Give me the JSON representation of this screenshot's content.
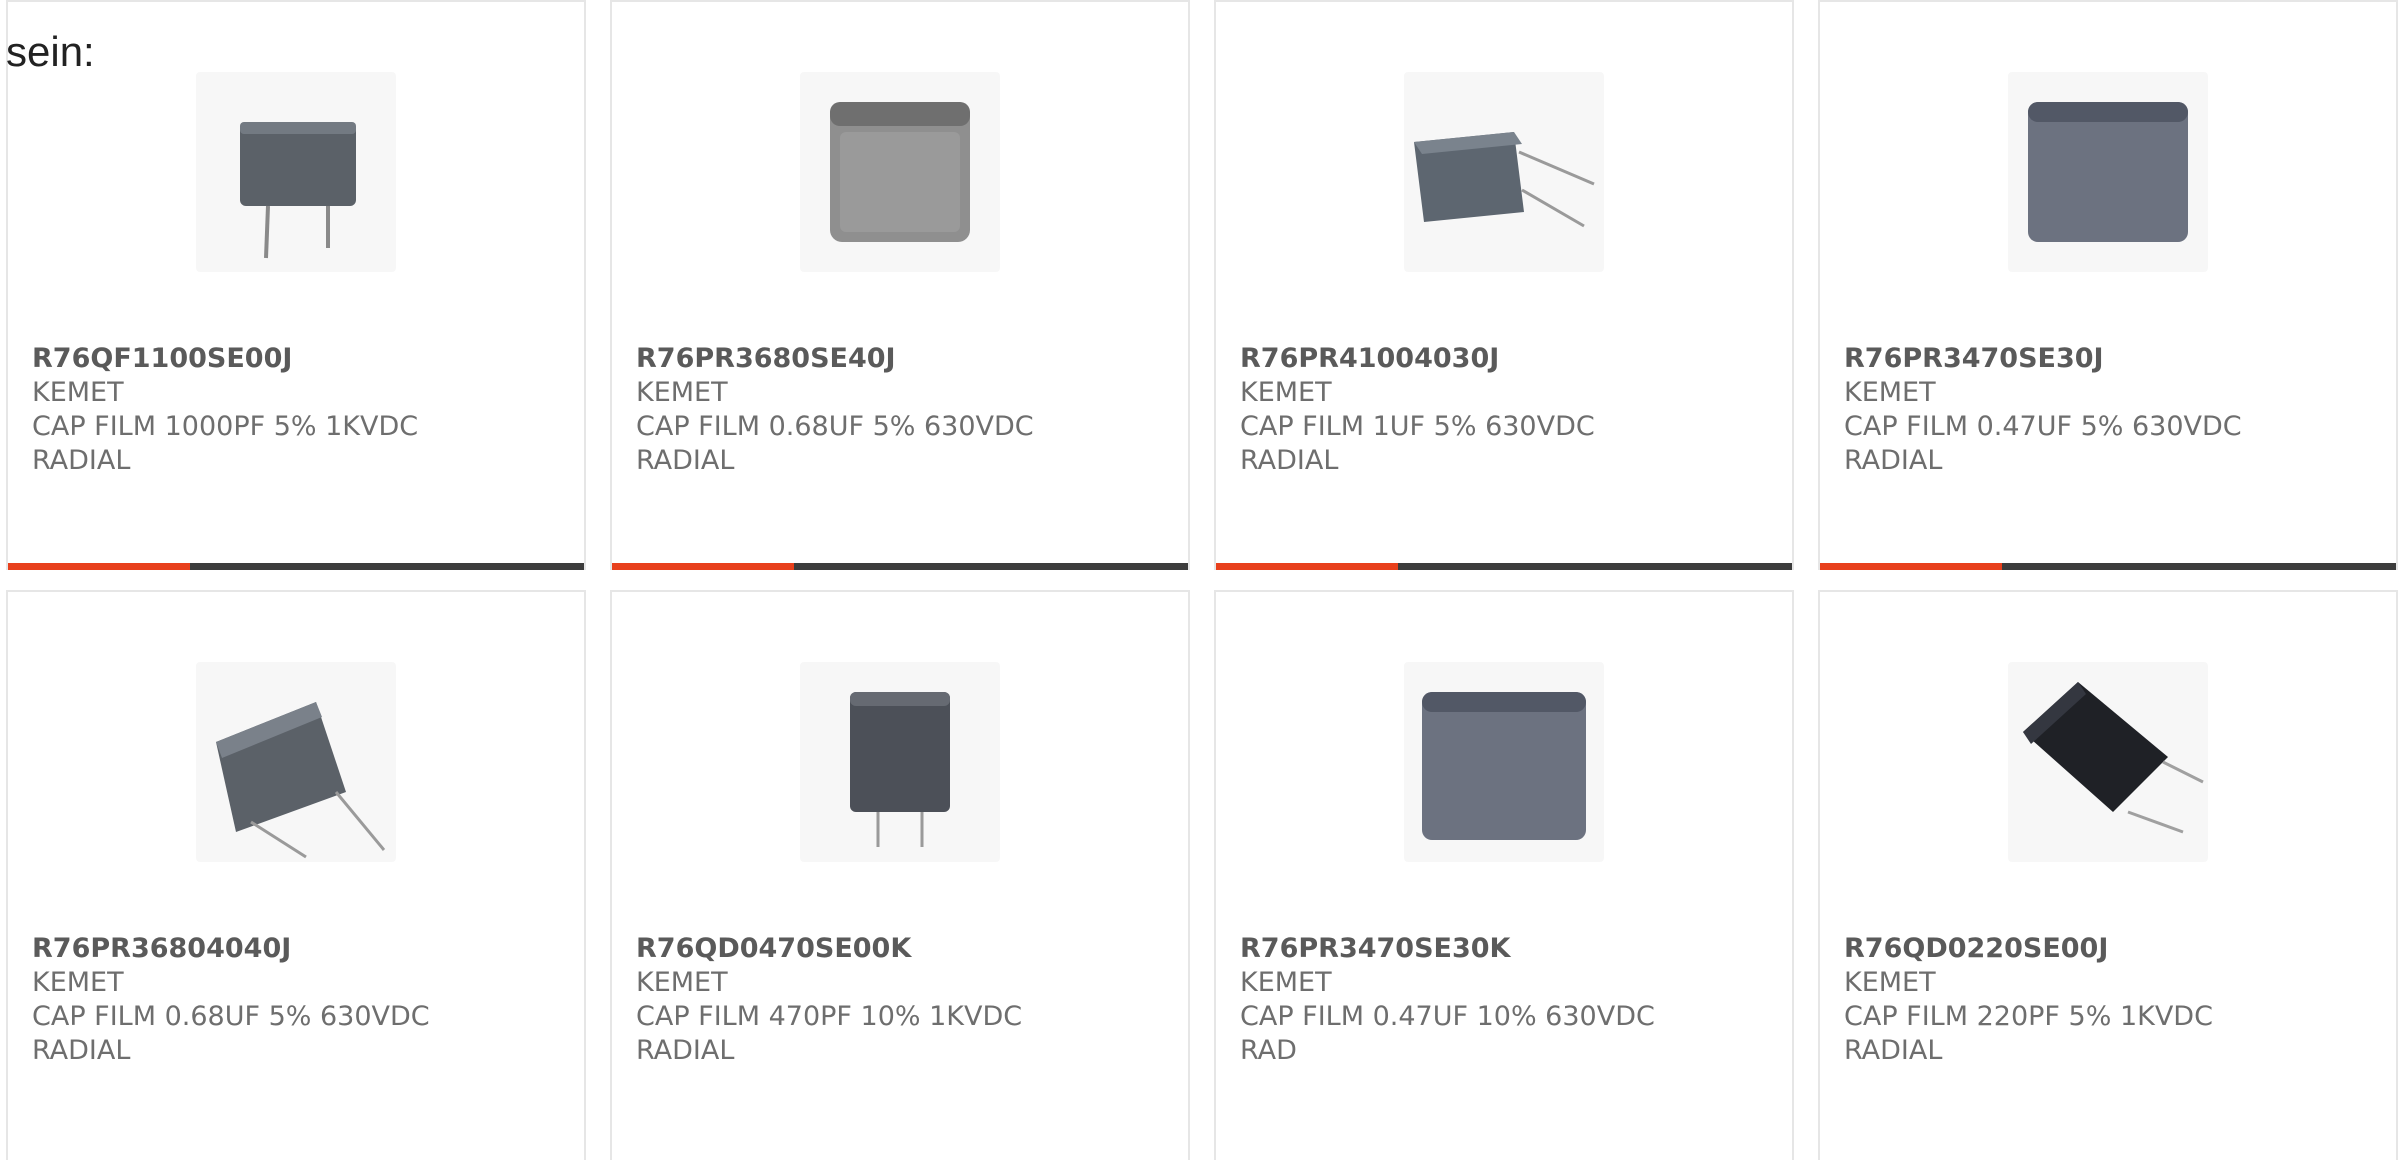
{
  "intro_text": "sein:",
  "colors": {
    "accent": "#e8401c",
    "bar": "#3c3c3c",
    "text": "#6e6e6e",
    "border": "#e6e6e6"
  },
  "products": [
    {
      "part": "R76QF1100SE00J",
      "maker": "KEMET",
      "desc1": "CAP FILM 1000PF 5% 1KVDC",
      "desc2": "RADIAL",
      "icon": "film-capacitor-icon",
      "style": "rect-legs-down"
    },
    {
      "part": "R76PR3680SE40J",
      "maker": "KEMET",
      "desc1": "CAP FILM 0.68UF 5% 630VDC",
      "desc2": "RADIAL",
      "icon": "film-capacitor-icon",
      "style": "box-gray"
    },
    {
      "part": "R76PR41004030J",
      "maker": "KEMET",
      "desc1": "CAP FILM 1UF 5% 630VDC",
      "desc2": "RADIAL",
      "icon": "film-capacitor-icon",
      "style": "angled-legs-right"
    },
    {
      "part": "R76PR3470SE30J",
      "maker": "KEMET",
      "desc1": "CAP FILM 0.47UF 5% 630VDC",
      "desc2": "RADIAL",
      "icon": "film-capacitor-icon",
      "style": "box-blue-gray"
    },
    {
      "part": "R76PR36804040J",
      "maker": "KEMET",
      "desc1": "CAP FILM 0.68UF 5% 630VDC",
      "desc2": "RADIAL",
      "icon": "film-capacitor-icon",
      "style": "angled-legs-down"
    },
    {
      "part": "R76QD0470SE00K",
      "maker": "KEMET",
      "desc1": "CAP FILM 470PF 10% 1KVDC",
      "desc2": "RADIAL",
      "icon": "film-capacitor-icon",
      "style": "small-dark"
    },
    {
      "part": "R76PR3470SE30K",
      "maker": "KEMET",
      "desc1": "CAP FILM 0.47UF 10% 630VDC",
      "desc2": "RAD",
      "icon": "film-capacitor-icon",
      "style": "box-blue-gray"
    },
    {
      "part": "R76QD0220SE00J",
      "maker": "KEMET",
      "desc1": "CAP FILM 220PF 5% 1KVDC",
      "desc2": "RADIAL",
      "icon": "film-capacitor-icon",
      "style": "black-angled"
    }
  ]
}
